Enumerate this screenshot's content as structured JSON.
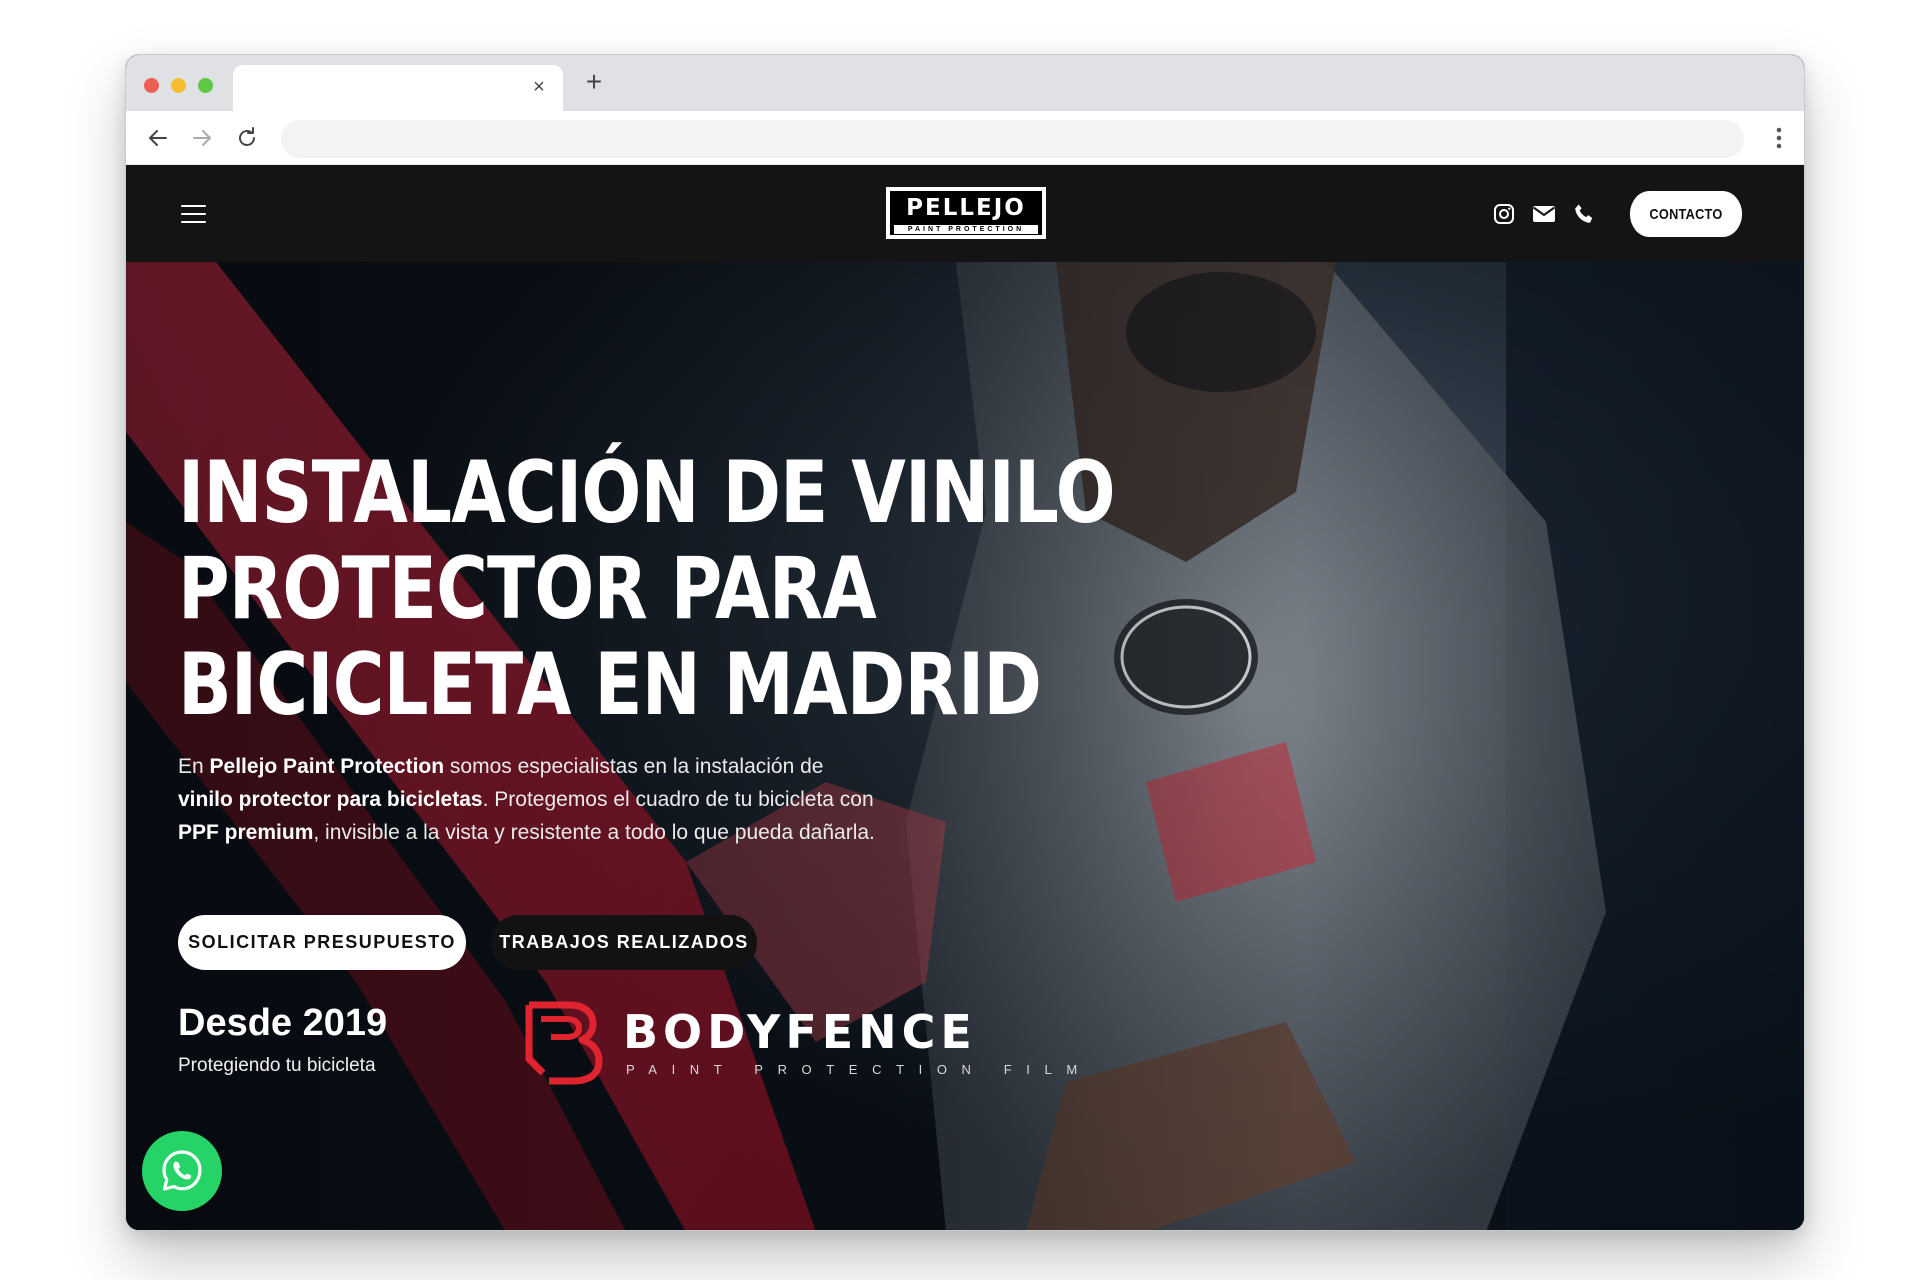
{
  "browser": {
    "tab_title": "",
    "address": ""
  },
  "site": {
    "logo": {
      "main": "PELLEJO",
      "sub": "PAINT PROTECTION"
    },
    "header": {
      "contact_label": "CONTACTO",
      "icons": [
        "menu-icon",
        "instagram-icon",
        "mail-icon",
        "phone-icon"
      ]
    },
    "hero": {
      "title_lines": [
        "INSTALACIÓN DE VINILO",
        "PROTECTOR PARA",
        "BICICLETA EN MADRID"
      ],
      "intro": {
        "p1": "En ",
        "b1": "Pellejo Paint Protection",
        "p2": " somos especialistas en la instalación de ",
        "b2": "vinilo protector para bicicletas",
        "p3": ". Protegemos el cuadro de tu bicicleta con ",
        "b3": "PPF premium",
        "p4": ", invisible a la vista y resistente a todo lo que pueda dañarla."
      },
      "cta_primary": "SOLICITAR PRESUPUESTO",
      "cta_secondary": "TRABAJOS REALIZADOS",
      "since": "Desde 2019",
      "since_sub": "Protegiendo tu bicicleta"
    },
    "partner": {
      "name": "BODYFENCE",
      "tagline": "PAINT PROTECTION FILM"
    },
    "colors": {
      "header_bg": "#141414",
      "accent_red": "#e0242f",
      "whatsapp": "#25d366"
    }
  }
}
